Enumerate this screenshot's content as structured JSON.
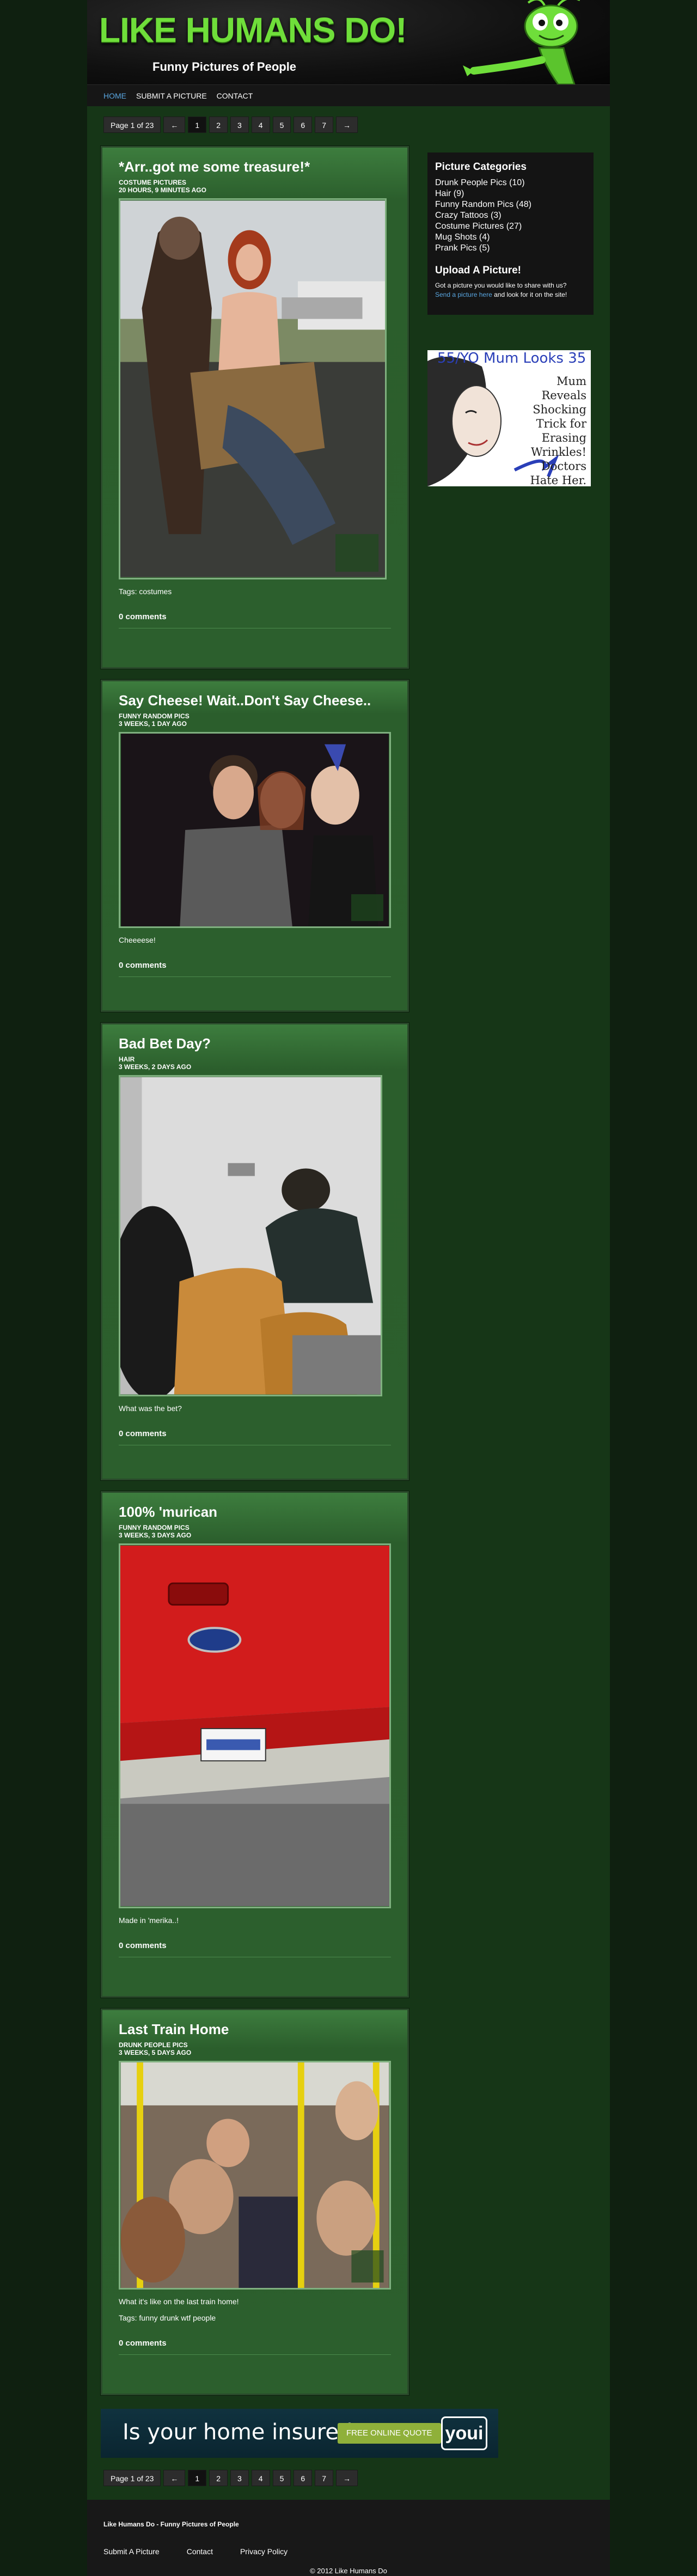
{
  "header": {
    "logo": "LIKE HUMANS DO!",
    "tagline": "Funny Pictures of People"
  },
  "nav": [
    {
      "label": "HOME",
      "active": true
    },
    {
      "label": "SUBMIT A PICTURE",
      "active": false
    },
    {
      "label": "CONTACT",
      "active": false
    }
  ],
  "pagination": {
    "label": "Page 1 of 23",
    "prev": "←",
    "next": "→",
    "pages": [
      "1",
      "2",
      "3",
      "4",
      "5",
      "6",
      "7"
    ],
    "current": "1"
  },
  "posts": [
    {
      "title": "*Arr..got me some treasure!*",
      "category": "COSTUME PICTURES",
      "time": "20 HOURS, 9 MINUTES AGO",
      "caption": "",
      "tags": "Tags: costumes",
      "comments": "0 comments"
    },
    {
      "title": "Say Cheese! Wait..Don't Say Cheese..",
      "category": "FUNNY RANDOM PICS",
      "time": "3 WEEKS, 1 DAY AGO",
      "caption": "Cheeeese!",
      "tags": "",
      "comments": "0 comments"
    },
    {
      "title": "Bad Bet Day?",
      "category": "HAIR",
      "time": "3 WEEKS, 2 DAYS AGO",
      "caption": "What was the bet?",
      "tags": "",
      "comments": "0 comments"
    },
    {
      "title": "100% 'murican",
      "category": "FUNNY RANDOM PICS",
      "time": "3 WEEKS, 3 DAYS AGO",
      "caption": "Made in 'merika..!",
      "tags": "",
      "comments": "0 comments"
    },
    {
      "title": "Last Train Home",
      "category": "DRUNK PEOPLE PICS",
      "time": "3 WEEKS, 5 DAYS AGO",
      "caption": "What it's like on the last train home!",
      "tags": "Tags: funny drunk wtf people",
      "comments": "0 comments"
    }
  ],
  "sidebar": {
    "categories_title": "Picture Categories",
    "categories": [
      "Drunk People Pics (10)",
      "Hair (9)",
      "Funny Random Pics (48)",
      "Crazy Tattoos (3)",
      "Costume Pictures (27)",
      "Mug Shots (4)",
      "Prank Pics (5)"
    ],
    "upload_title": "Upload A Picture!",
    "upload_text": "Got a picture you would like to share with us?",
    "upload_link": "Send a picture here",
    "upload_text2": "and look for it on the site!"
  },
  "ads": {
    "side_headline": "55/YO Mum Looks 35",
    "side_text": "Mum Reveals Shocking Trick for Erasing Wrinkles! Doctors Hate Her.",
    "bottom_question": "Is your home insured?",
    "bottom_button": "FREE ONLINE QUOTE",
    "bottom_brand": "youi"
  },
  "footer": {
    "title": "Like Humans Do - Funny Pictures of People",
    "links": [
      "Submit A Picture",
      "Contact",
      "Privacy Policy"
    ],
    "copyright": "© 2012 Like Humans Do"
  },
  "colors": {
    "background": "#0f2010",
    "post_green": "#2c5f2d",
    "logo_green": "#6fde3a",
    "link_blue": "#59a6e0"
  }
}
